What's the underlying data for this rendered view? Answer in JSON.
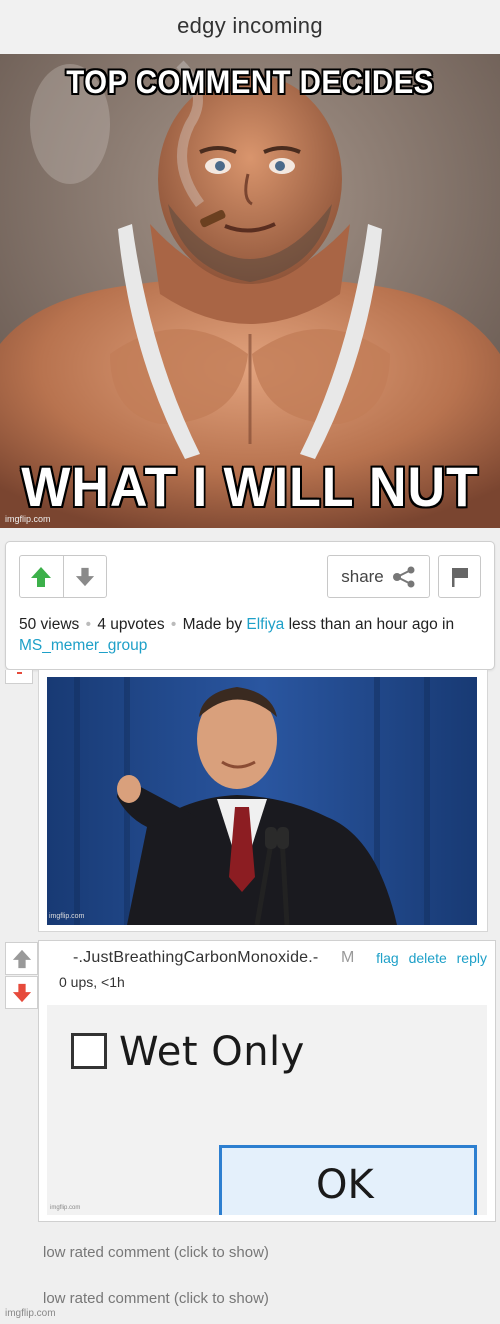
{
  "header": {
    "title": "edgy incoming"
  },
  "meme": {
    "top_caption": "TOP COMMENT DECIDES",
    "bottom_caption": "WHAT I WILL NUT TO",
    "watermark": "imgflip.com"
  },
  "post": {
    "share_label": "share",
    "views": "50 views",
    "upvotes": "4 upvotes",
    "made_by": "Made by",
    "author": "Elfiya",
    "time": "less than an hour ago in",
    "group": "MS_memer_group"
  },
  "reply_image": {
    "watermark": "imgflip.com"
  },
  "comment": {
    "username": "-.JustBreathingCarbonMonoxide.-",
    "badge": "M",
    "actions": [
      "flag",
      "delete",
      "reply"
    ],
    "info": "0 ups, <1h",
    "image": {
      "checkbox_label": "Wet Only",
      "button_label": "OK",
      "watermark": "imgflip.com"
    }
  },
  "low_rated": [
    "low rated comment (click to show)",
    "low rated comment (click to show)"
  ],
  "footer": {
    "watermark": "imgflip.com"
  },
  "colors": {
    "accent_link": "#1ea0c8",
    "upvote": "#3cb04a",
    "downvote": "#e64a3b"
  }
}
